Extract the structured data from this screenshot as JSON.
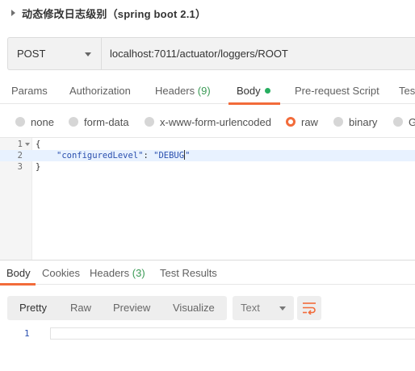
{
  "title": "动态修改日志级别（spring boot 2.1）",
  "request": {
    "method": "POST",
    "url": "localhost:7011/actuator/loggers/ROOT"
  },
  "request_tabs": [
    {
      "label": "Params"
    },
    {
      "label": "Authorization"
    },
    {
      "label": "Headers",
      "count": "(9)"
    },
    {
      "label": "Body",
      "active": true
    },
    {
      "label": "Pre-request Script"
    },
    {
      "label": "Tes"
    }
  ],
  "body_types": [
    {
      "label": "none"
    },
    {
      "label": "form-data"
    },
    {
      "label": "x-www-form-urlencoded"
    },
    {
      "label": "raw",
      "selected": true
    },
    {
      "label": "binary"
    },
    {
      "label": "G"
    }
  ],
  "editor": {
    "line_numbers": [
      "1",
      "2",
      "3"
    ],
    "line1": "{",
    "key": "\"configuredLevel\"",
    "colon": ": ",
    "value_before_cursor": "\"DEBUG",
    "value_after_cursor": "\"",
    "line3": "}"
  },
  "response_tabs": [
    {
      "label": "Body",
      "active": true
    },
    {
      "label": "Cookies"
    },
    {
      "label": "Headers",
      "count": "(3)"
    },
    {
      "label": "Test Results"
    }
  ],
  "response_toolbar": {
    "views": [
      "Pretty",
      "Raw",
      "Preview",
      "Visualize"
    ],
    "format": "Text"
  },
  "response_body": {
    "line_number": "1"
  },
  "colors": {
    "accent": "#f26b3a",
    "body_dot": "#27ae60",
    "count": "#3a9a55",
    "json_text": "#2a4fae"
  },
  "icons": {
    "wrap": "wrap-lines-icon",
    "expand": "caret-right-icon",
    "dropdown": "chevron-down-icon"
  }
}
